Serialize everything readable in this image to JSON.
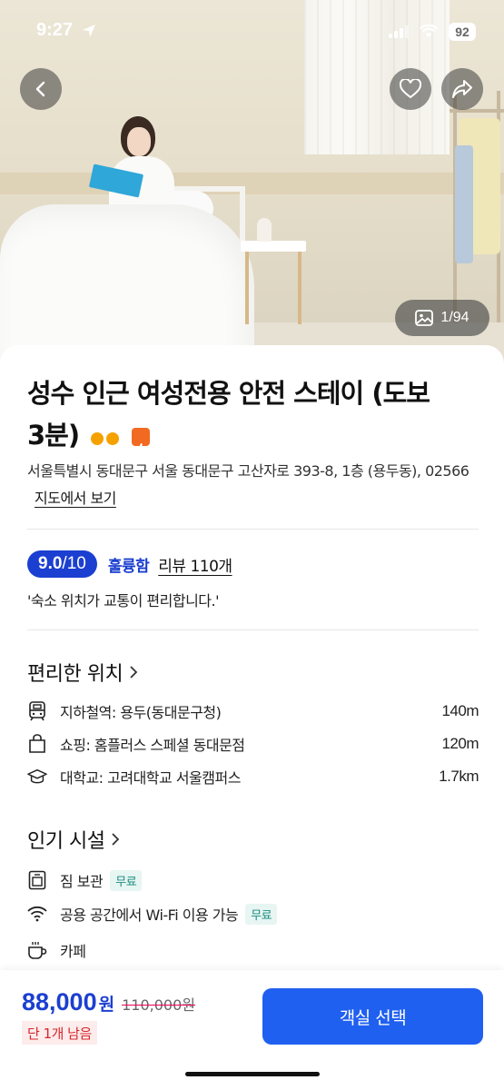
{
  "status_bar": {
    "time": "9:27",
    "battery": "92"
  },
  "hero": {
    "photo_counter": "1/94"
  },
  "listing": {
    "title_line1": "성수 인근 여성전용 안전 스테이 (도보",
    "title_line2": "3분)",
    "address_text": "서울특별시 동대문구 서울 동대문구 고산자로 393-8, 1층 (용두동), 02566",
    "map_link": "지도에서 보기"
  },
  "rating": {
    "score": "9.0",
    "max": "/10",
    "word": "훌륭함",
    "review_link": "리뷰 110개",
    "quote": "'숙소 위치가 교통이 편리합니다.'"
  },
  "location": {
    "title": "편리한 위치",
    "items": [
      {
        "icon": "subway-icon",
        "label": "지하철역: 용두(동대문구청)",
        "distance": "140m"
      },
      {
        "icon": "shopping-bag-icon",
        "label": "쇼핑: 홈플러스 스페셜 동대문점",
        "distance": "120m"
      },
      {
        "icon": "graduation-cap-icon",
        "label": "대학교: 고려대학교 서울캠퍼스",
        "distance": "1.7km"
      }
    ]
  },
  "facilities": {
    "title": "인기 시설",
    "items": [
      {
        "icon": "luggage-icon",
        "label": "짐 보관",
        "badge": "무료"
      },
      {
        "icon": "wifi-icon",
        "label": "공용 공간에서 Wi-Fi 이용 가능",
        "badge": "무료"
      },
      {
        "icon": "coffee-icon",
        "label": "카페"
      }
    ]
  },
  "booking": {
    "price": "88,000",
    "currency": "원",
    "original_price": "110,000원",
    "remaining": "단 1개 남음",
    "cta": "객실 선택"
  },
  "colors": {
    "accent": "#1b3fd0",
    "cta": "#2060f0",
    "free_text": "#1a8c7e",
    "remain_text": "#d6262b"
  }
}
